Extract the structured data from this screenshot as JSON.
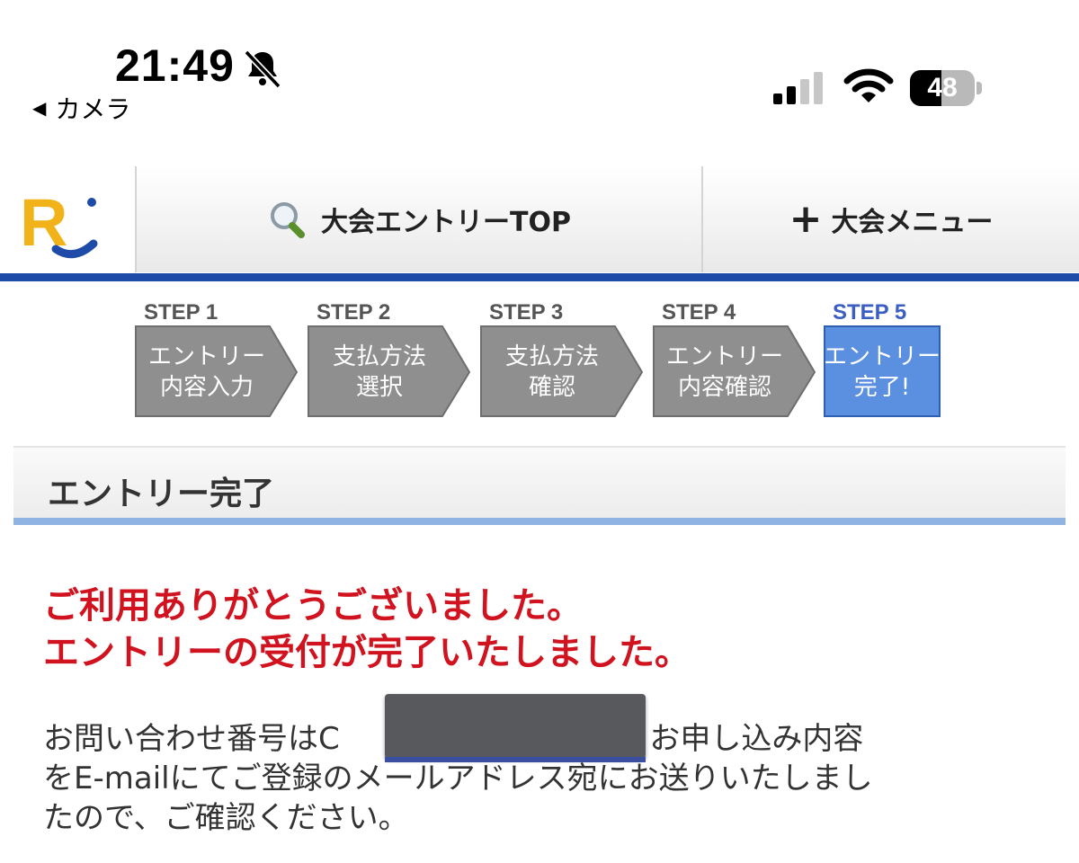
{
  "status_bar": {
    "time": "21:49",
    "back_app": "カメラ",
    "battery_level": "48",
    "battery_fraction": 0.48
  },
  "header": {
    "logo_letter": "R",
    "nav_top": "大会エントリーTOP",
    "nav_menu": "大会メニュー",
    "accent_color": "#1e4aa8"
  },
  "steps": [
    {
      "label": "STEP 1",
      "line1": "エントリー",
      "line2": "内容入力",
      "active": false
    },
    {
      "label": "STEP 2",
      "line1": "支払方法",
      "line2": "選択",
      "active": false
    },
    {
      "label": "STEP 3",
      "line1": "支払方法",
      "line2": "確認",
      "active": false
    },
    {
      "label": "STEP 4",
      "line1": "エントリー",
      "line2": "内容確認",
      "active": false
    },
    {
      "label": "STEP 5",
      "line1": "エントリー",
      "line2": "完了!",
      "active": true
    }
  ],
  "section_title": "エントリー完了",
  "thanks": {
    "line1": "ご利用ありがとうございました。",
    "line2": "エントリーの受付が完了いたしました。",
    "color": "#d1121f"
  },
  "body": {
    "line1_pre": "お問い合わせ番号はC",
    "line1_post": "です。お申し込み内容",
    "line2": "をE-mailにてご登録のメールアドレス宛にお送りいたしまし",
    "line3": "たので、ご確認ください。"
  }
}
